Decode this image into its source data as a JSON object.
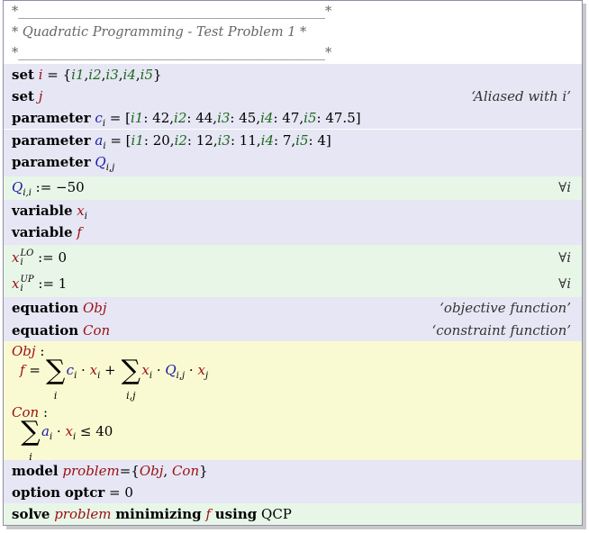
{
  "header": {
    "rule_top": "*_______________________________________________*",
    "title": "* Quadratic Programming - Test Problem 1 *",
    "rule_bottom": "*_______________________________________________*"
  },
  "set_i": {
    "kw": "set",
    "name": "i",
    "eq": " = {",
    "members": [
      "i1",
      "i2",
      "i3",
      "i4",
      "i5"
    ],
    "close": "}"
  },
  "set_j": {
    "kw": "set",
    "name": "j",
    "comment": "‘Aliased with i’"
  },
  "param_c": {
    "kw": "parameter",
    "name": "c",
    "sub": "i",
    "entries": [
      [
        "i1",
        "42"
      ],
      [
        "i2",
        "44"
      ],
      [
        "i3",
        "45"
      ],
      [
        "i4",
        "47"
      ],
      [
        "i5",
        "47.5"
      ]
    ]
  },
  "param_a": {
    "kw": "parameter",
    "name": "a",
    "sub": "i",
    "entries": [
      [
        "i1",
        "20"
      ],
      [
        "i2",
        "12"
      ],
      [
        "i3",
        "11"
      ],
      [
        "i4",
        "7"
      ],
      [
        "i5",
        "4"
      ]
    ]
  },
  "param_Q": {
    "kw": "parameter",
    "name": "Q",
    "sub": "i,j"
  },
  "assign_Q": {
    "name": "Q",
    "sub": "i,i",
    "rhs": " := −50",
    "forall": "∀i"
  },
  "var_x": {
    "kw": "variable",
    "name": "x",
    "sub": "i"
  },
  "var_f": {
    "kw": "variable",
    "name": "f"
  },
  "bound_lo": {
    "name": "x",
    "sup": "LO",
    "sub": "i",
    "rhs": " := 0",
    "forall": "∀i"
  },
  "bound_up": {
    "name": "x",
    "sup": "UP",
    "sub": "i",
    "rhs": " := 1",
    "forall": "∀i"
  },
  "eq_obj": {
    "kw": "equation",
    "name": "Obj",
    "comment": "‘objective function’"
  },
  "eq_con": {
    "kw": "equation",
    "name": "Con",
    "comment": "‘constraint function’"
  },
  "def_obj": {
    "label": "Obj",
    "colon": " :",
    "lhs": "f",
    "eq": " = ",
    "sum1_index": "i",
    "term1_c": "c",
    "term1_c_sub": "i",
    "dot": " · ",
    "term1_x": "x",
    "term1_x_sub": "i",
    "plus": " + ",
    "sum2_index": "i,j",
    "term2_x": "x",
    "term2_x_sub": "i",
    "term2_Q": "Q",
    "term2_Q_sub": "i,j",
    "term2_xj": "x",
    "term2_xj_sub": "j",
    "sigma": "∑"
  },
  "def_con": {
    "label": "Con",
    "colon": " :",
    "sum_index": "i",
    "a": "a",
    "a_sub": "i",
    "dot": " · ",
    "x": "x",
    "x_sub": "i",
    "rhs": " ≤ 40",
    "sigma": "∑"
  },
  "model": {
    "kw": "model",
    "name": "problem",
    "eq": "={",
    "members": [
      "Obj",
      "Con"
    ],
    "close": "}"
  },
  "option": {
    "kw": "option",
    "name": "optcr",
    "rhs": " = 0"
  },
  "solve": {
    "kw": "solve",
    "name": "problem",
    "kw2": "minimizing",
    "var": "f",
    "kw3": "using",
    "type": "QCP"
  },
  "colors": {
    "lavender": "#e6e6f4",
    "green": "#e8f6e8",
    "yellow": "#fafad2",
    "blue": "#1a1aa8",
    "red": "#9b1010",
    "index_green": "#1c6a1c"
  }
}
